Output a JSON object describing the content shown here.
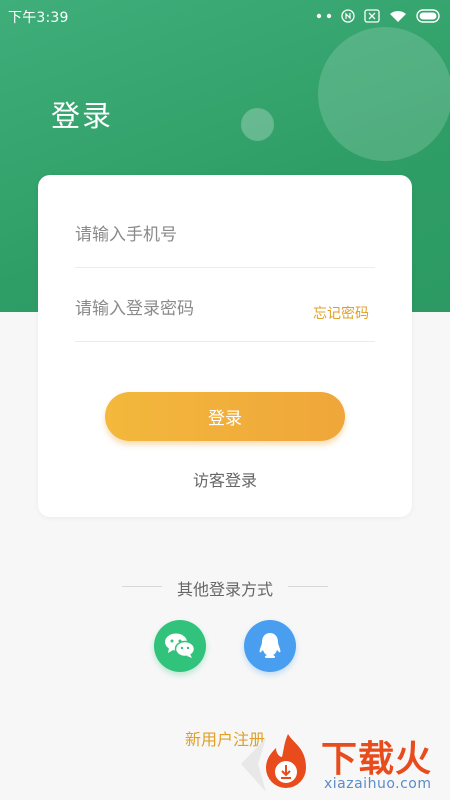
{
  "status_bar": {
    "time": "下午3:39"
  },
  "header": {
    "title": "登录"
  },
  "form": {
    "phone_placeholder": "请输入手机号",
    "password_placeholder": "请输入登录密码",
    "forgot_label": "忘记密码",
    "login_label": "登录",
    "guest_label": "访客登录"
  },
  "other_login": {
    "label": "其他登录方式",
    "options": [
      {
        "name": "wechat",
        "icon": "wechat-icon",
        "color": "#31c27c"
      },
      {
        "name": "qq",
        "icon": "qq-icon",
        "color": "#4a9ef0"
      }
    ]
  },
  "register_label": "新用户注册",
  "watermark": {
    "text": "下载火",
    "sub": "xiazaihuo.com"
  },
  "colors": {
    "primary": "#2f9e66",
    "accent": "#efa63a",
    "link": "#e0a028"
  }
}
